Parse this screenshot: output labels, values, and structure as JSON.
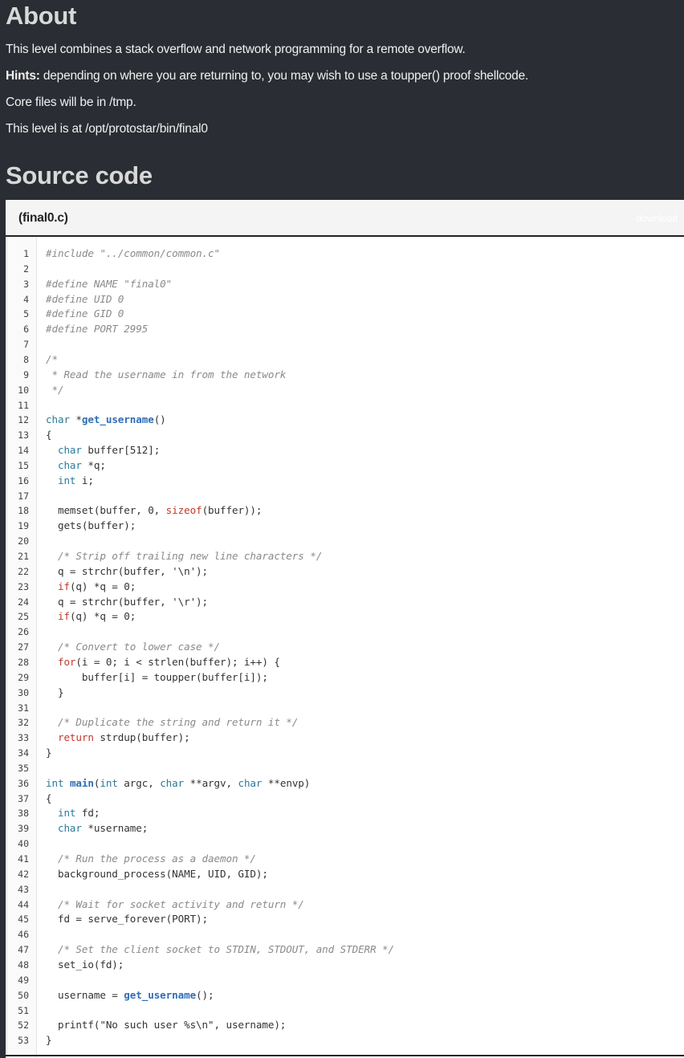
{
  "about": {
    "title": "About",
    "para1": "This level combines a stack overflow and network programming for a remote overflow.",
    "hints_label": "Hints:",
    "hints_text": " depending on where you are returning to, you may wish to use a toupper() proof shellcode.",
    "para3": "Core files will be in /tmp.",
    "para4": "This level is at /opt/protostar/bin/final0"
  },
  "source": {
    "title": "Source code",
    "filename": "(final0.c)",
    "download_label": "download"
  },
  "code_lines": [
    "#include \"../common/common.c\"",
    "",
    "#define NAME \"final0\"",
    "#define UID 0",
    "#define GID 0",
    "#define PORT 2995",
    "",
    "/*",
    " * Read the username in from the network",
    " */",
    "",
    "char *get_username()",
    "{",
    "  char buffer[512];",
    "  char *q;",
    "  int i;",
    "",
    "  memset(buffer, 0, sizeof(buffer));",
    "  gets(buffer);",
    "",
    "  /* Strip off trailing new line characters */",
    "  q = strchr(buffer, '\\n');",
    "  if(q) *q = 0;",
    "  q = strchr(buffer, '\\r');",
    "  if(q) *q = 0;",
    "",
    "  /* Convert to lower case */",
    "  for(i = 0; i < strlen(buffer); i++) {",
    "      buffer[i] = toupper(buffer[i]);",
    "  }",
    "",
    "  /* Duplicate the string and return it */",
    "  return strdup(buffer);",
    "}",
    "",
    "int main(int argc, char **argv, char **envp)",
    "{",
    "  int fd;",
    "  char *username;",
    "",
    "  /* Run the process as a daemon */",
    "  background_process(NAME, UID, GID);",
    "",
    "  /* Wait for socket activity and return */",
    "  fd = serve_forever(PORT);",
    "",
    "  /* Set the client socket to STDIN, STDOUT, and STDERR */",
    "  set_io(fd);",
    "",
    "  username = get_username();",
    "",
    "  printf(\"No such user %s\\n\", username);",
    "}"
  ],
  "colors": {
    "page_bg": "#2a2d33",
    "comment": "#8a8a8a",
    "keyword": "#2a7a9a",
    "control": "#c0392b",
    "function": "#2f6eb5"
  }
}
